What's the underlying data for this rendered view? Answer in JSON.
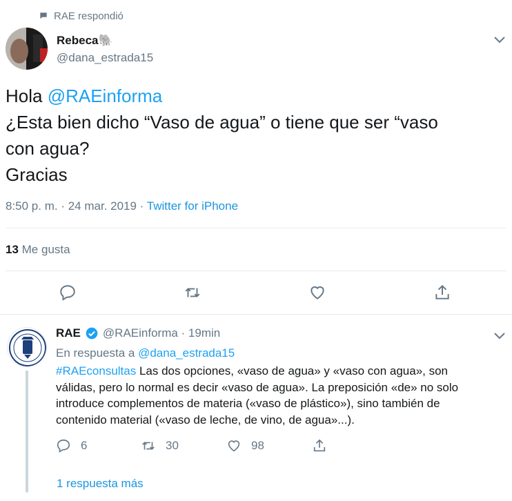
{
  "context": {
    "label": "RAE respondió",
    "icon": "speech-bubble-icon"
  },
  "main_tweet": {
    "author_name": "Rebeca🐘",
    "author_handle": "@dana_estrada15",
    "text_lines": [
      {
        "prefix": "Hola ",
        "mention": "@RAEinforma"
      },
      {
        "text": "¿Esta bien dicho “Vaso de agua” o tiene que ser “vaso"
      },
      {
        "text": "con agua?"
      },
      {
        "text": "Gracias"
      }
    ],
    "time": "8:50 p. m. · 24 mar. 2019 · ",
    "source": "Twitter for iPhone",
    "likes_count": "13",
    "likes_label": " Me gusta",
    "actions": [
      "reply-icon",
      "retweet-icon",
      "like-icon",
      "share-icon"
    ]
  },
  "reply_tweet": {
    "author_name": "RAE",
    "author_handle": "@RAEinforma · 19min",
    "in_reply_prefix": "En respuesta a ",
    "in_reply_mention": "@dana_estrada15",
    "hashtag": "#RAEconsultas",
    "text_line_1": " Las dos opciones, «vaso de agua» y «vaso con agua», son",
    "text_line_2": "válidas, pero lo normal es decir «vaso de agua». La preposición «de» no solo",
    "text_line_3": "introduce complementos de materia («vaso de plástico»), sino también de",
    "text_line_4": "contenido material («vaso de leche, de vino, de agua»...).",
    "reply_count": "6",
    "retweet_count": "30",
    "like_count": "98"
  },
  "more_replies": "1 respuesta más",
  "colors": {
    "accent": "#1da1f2",
    "link": "#1b95e0",
    "muted": "#657786",
    "divider": "#e6ecf0"
  }
}
